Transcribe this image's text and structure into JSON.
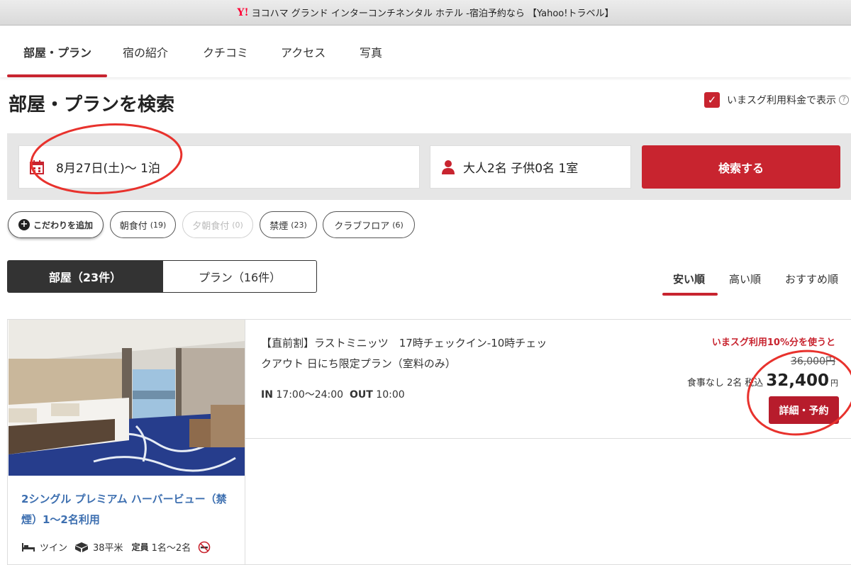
{
  "window": {
    "logo_text": "Y!",
    "title": "ヨコハマ グランド インターコンチネンタル ホテル -宿泊予約なら 【Yahoo!トラベル】"
  },
  "nav": {
    "tabs": [
      {
        "label": "部屋・プラン",
        "active": true
      },
      {
        "label": "宿の紹介"
      },
      {
        "label": "クチコミ"
      },
      {
        "label": "アクセス"
      },
      {
        "label": "写真"
      }
    ]
  },
  "search": {
    "title": "部屋・プランを検索",
    "now_price_label": "いまスグ利用料金で表示",
    "now_price_checked": true,
    "help_symbol": "?",
    "date_value": "8月27日(土)〜 1泊",
    "guests_value": "大人2名 子供0名 1室",
    "button_label": "検索する"
  },
  "filters": {
    "add_label": "こだわりを追加",
    "chips": [
      {
        "label": "朝食付",
        "count": "(19)"
      },
      {
        "label": "夕朝食付",
        "count": "(0)",
        "disabled": true
      },
      {
        "label": "禁煙",
        "count": "(23)"
      },
      {
        "label": "クラブフロア",
        "count": "(6)"
      }
    ]
  },
  "view_toggle": {
    "rooms_label": "部屋（23件）",
    "plans_label": "プラン（16件）",
    "active": "rooms"
  },
  "sort": {
    "options": [
      "安い順",
      "高い順",
      "おすすめ順"
    ],
    "active": "安い順"
  },
  "room": {
    "name": "2シングル プレミアム ハーバービュー（禁煙）1〜2名利用",
    "bed_type": "ツイン",
    "area": "38平米",
    "capacity_label": "定員",
    "capacity": "1名〜2名",
    "plan": {
      "name": "【直前割】ラストミニッツ　17時チェックイン-10時チェックアウト 日にち限定プラン（室料のみ）",
      "in_label": "IN",
      "in_time": "17:00〜24:00",
      "out_label": "OUT",
      "out_time": "10:00",
      "discount_note": "いまスグ利用10%分を使うと",
      "original_price": "36,000円",
      "meal": "食事なし",
      "guests": "2名",
      "tax_label": "税込",
      "price": "32,400",
      "currency": "円",
      "book_label": "詳細・予約"
    }
  },
  "colors": {
    "accent": "#c8242f",
    "link": "#3d6fb0",
    "annotation": "#e8322d"
  }
}
